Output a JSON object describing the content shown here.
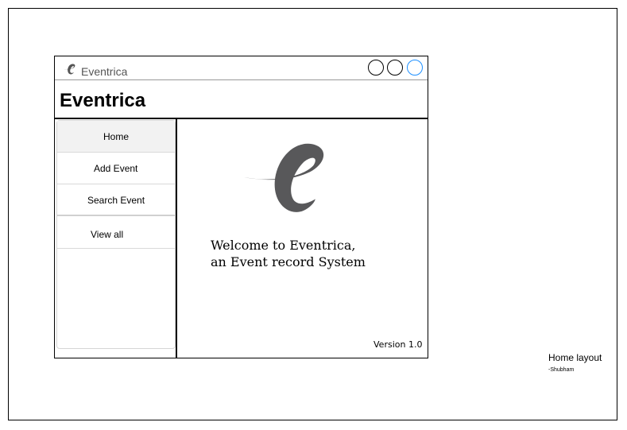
{
  "window": {
    "title": "Eventrica",
    "logo_icon": "eventrica-e-logo-icon",
    "controls": [
      "minimize-circle",
      "maximize-circle",
      "close-circle"
    ],
    "close_accent": "#1e90ff"
  },
  "header": {
    "title": "Eventrica"
  },
  "sidebar": {
    "items": [
      {
        "label": "Home",
        "active": true
      },
      {
        "label": "Add Event",
        "active": false
      },
      {
        "label": "Search Event",
        "active": false
      },
      {
        "label": "View all",
        "active": false
      }
    ]
  },
  "main": {
    "logo_icon": "eventrica-e-logo-icon",
    "logo_color": "#58585a",
    "welcome_line1": "Welcome to Eventrica,",
    "welcome_line2": "an Event record System",
    "version": "Version 1.0"
  },
  "caption": {
    "title": "Home layout",
    "author": "-Shubham"
  }
}
